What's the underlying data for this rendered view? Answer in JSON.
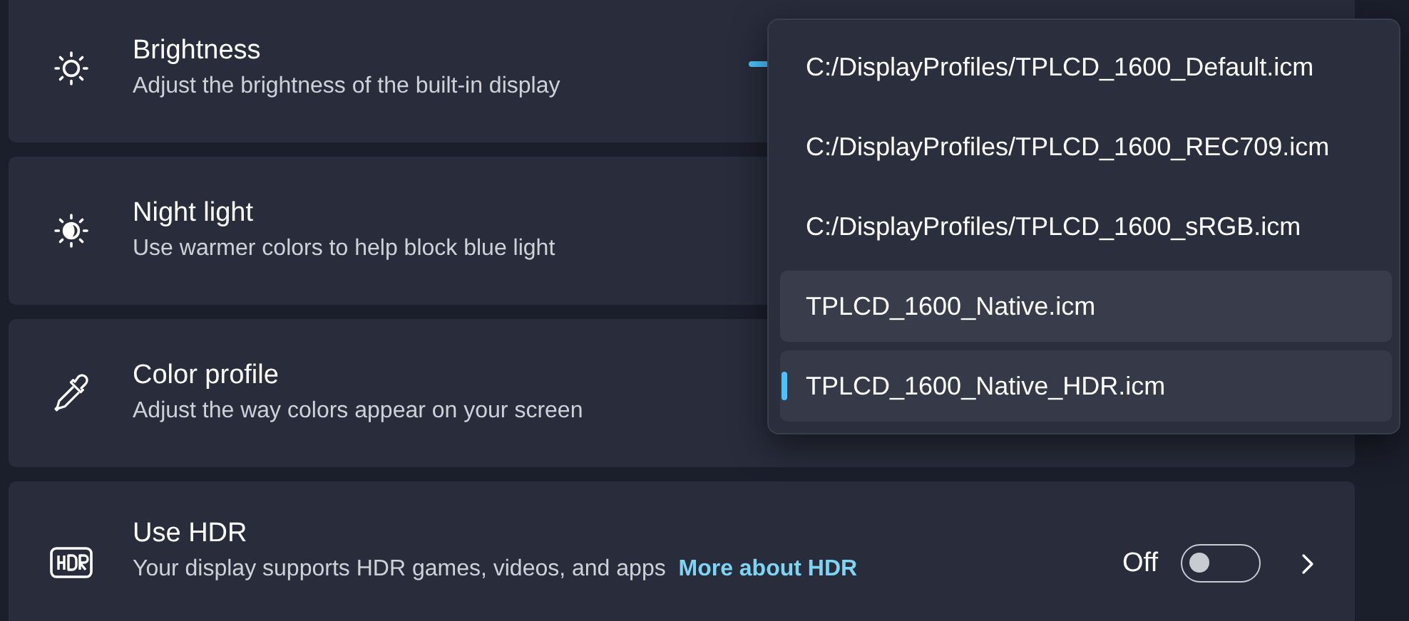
{
  "settings": [
    {
      "kind": "brightness",
      "title": "Brightness",
      "description": "Adjust the brightness of the built-in display"
    },
    {
      "kind": "night",
      "title": "Night light",
      "description": "Use warmer colors to help block blue light"
    },
    {
      "kind": "profile",
      "title": "Color profile",
      "description": "Adjust the way colors appear on your screen"
    },
    {
      "kind": "hdr",
      "title": "Use HDR",
      "description": "Your display supports HDR games, videos, and apps",
      "link": "More about HDR",
      "toggle_label": "Off",
      "on": false
    }
  ],
  "profile_menu": [
    {
      "label": "C:/DisplayProfiles/TPLCD_1600_Default.icm",
      "selected": false,
      "hovered": false
    },
    {
      "label": "C:/DisplayProfiles/TPLCD_1600_REC709.icm",
      "selected": false,
      "hovered": false
    },
    {
      "label": "C:/DisplayProfiles/TPLCD_1600_sRGB.icm",
      "selected": false,
      "hovered": false
    },
    {
      "label": "TPLCD_1600_Native.icm",
      "selected": false,
      "hovered": true
    },
    {
      "label": "TPLCD_1600_Native_HDR.icm",
      "selected": true,
      "hovered": false
    }
  ]
}
